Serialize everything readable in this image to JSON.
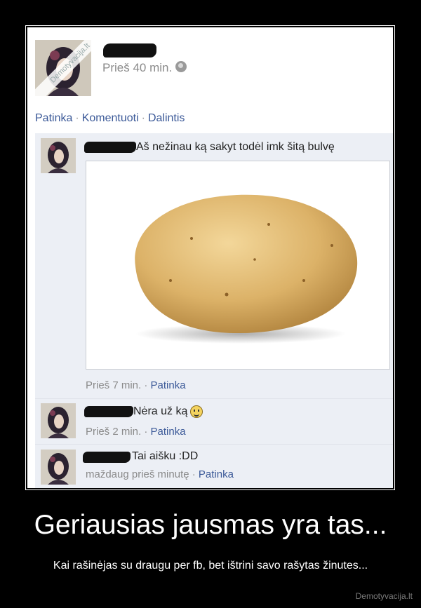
{
  "post": {
    "watermark": "Demotyvacija.lt",
    "time": "Prieš 40 min.",
    "actions": [
      "Patinka",
      "Komentuoti",
      "Dalintis"
    ]
  },
  "comments": [
    {
      "text": "Aš nežinau ką sakyt todėl imk šitą bulvę",
      "time": "Prieš 7 min.",
      "like": "Patinka"
    },
    {
      "text": "Nėra už ką",
      "time": "Prieš 2 min.",
      "like": "Patinka",
      "icon": "smiley-icon"
    },
    {
      "text": "Tai aišku :DD",
      "time": "maždaug prieš minutę",
      "like": "Patinka"
    }
  ],
  "caption": {
    "headline": "Geriausias jausmas yra tas...",
    "subline": "Kai rašinėjas su draugu per fb, bet ištrini savo rašytas žinutes..."
  },
  "site": "Demotyvacija.lt",
  "colors": {
    "link": "#3b5998",
    "comments_bg": "#eceff5",
    "page_bg": "#000000"
  }
}
